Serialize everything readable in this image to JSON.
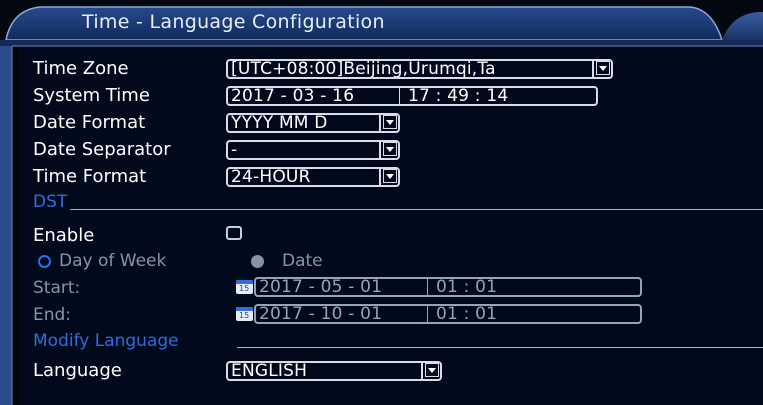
{
  "window": {
    "title": "Time - Language Configuration"
  },
  "time_zone": {
    "label": "Time Zone",
    "value": "[UTC+08:00]Beijing,Urumqi,Ta"
  },
  "system_time": {
    "label": "System Time",
    "date": "2017 - 03 - 16",
    "time": "17 : 49 : 14"
  },
  "date_format": {
    "label": "Date Format",
    "value": "YYYY MM D"
  },
  "date_separator": {
    "label": "Date Separator",
    "value": "-"
  },
  "time_format": {
    "label": "Time Format",
    "value": "24-HOUR"
  },
  "dst": {
    "section": "DST",
    "enable_label": "Enable",
    "enabled": false,
    "mode_day_of_week": "Day of Week",
    "mode_date": "Date",
    "selected_mode": "Date",
    "start_label": "Start:",
    "start_date": "2017 - 05 - 01",
    "start_time": "01 : 01",
    "end_label": "End:",
    "end_date": "2017 - 10 - 01",
    "end_time": "01 : 01",
    "calendar_icon_text": "15"
  },
  "language": {
    "section": "Modify Language",
    "label": "Language",
    "value": "ENGLISH"
  },
  "colors": {
    "accent": "#2f6de0",
    "background": "#000408",
    "frame": "#2a4a8a"
  }
}
